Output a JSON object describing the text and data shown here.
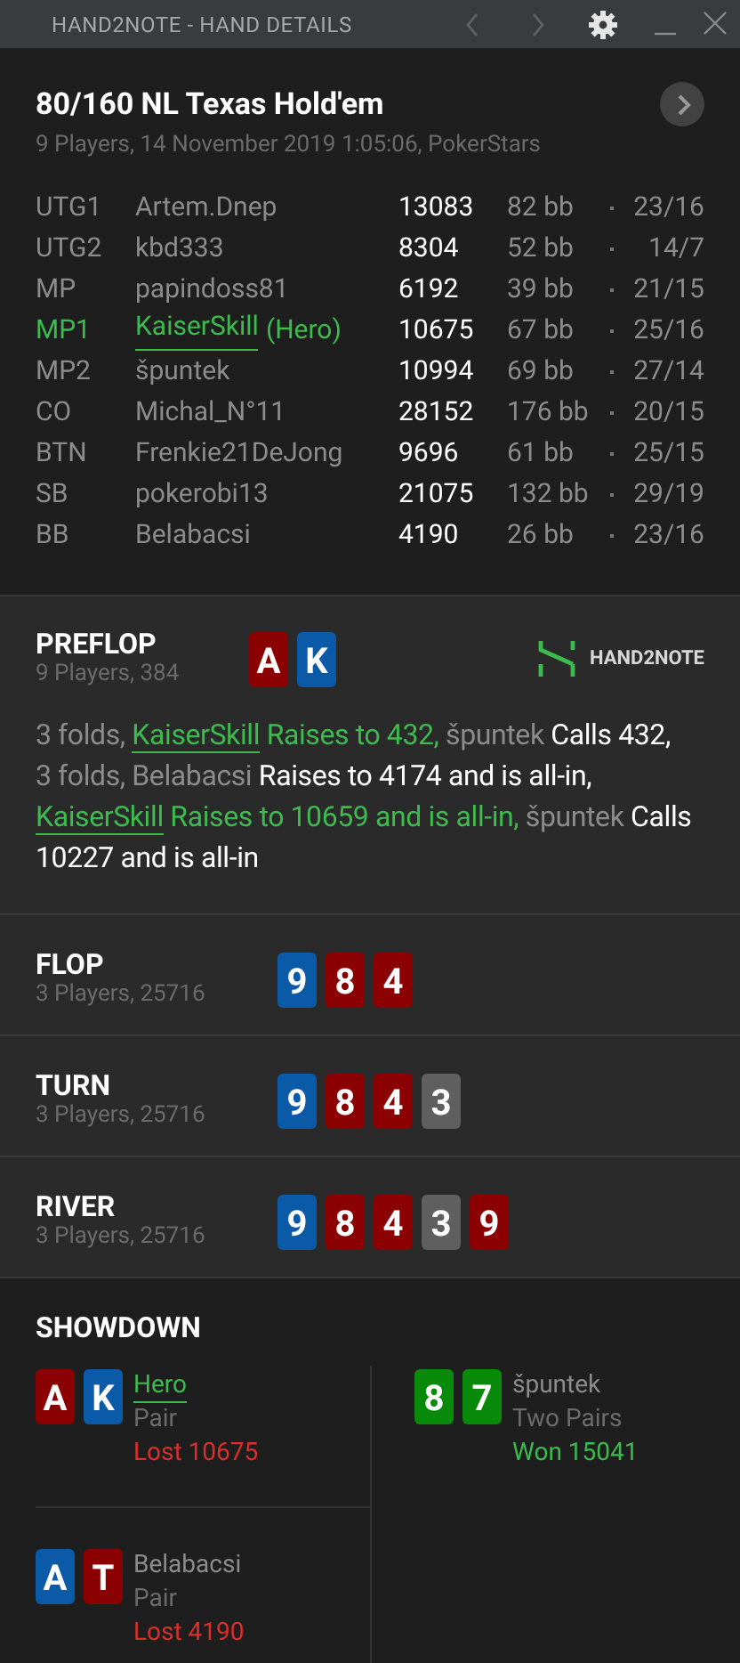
{
  "window": {
    "title": "HAND2NOTE - HAND DETAILS"
  },
  "hand": {
    "title": "80/160 NL Texas Hold'em",
    "subtitle": "9 Players, 14 November 2019 1:05:06, PokerStars"
  },
  "players": [
    {
      "position": "UTG1",
      "name": "Artem.Dnep",
      "stack": "13083",
      "bb": "82 bb",
      "ratio": "23/16",
      "hero": false
    },
    {
      "position": "UTG2",
      "name": "kbd333",
      "stack": "8304",
      "bb": "52 bb",
      "ratio": "14/7",
      "hero": false
    },
    {
      "position": "MP",
      "name": "papindoss81",
      "stack": "6192",
      "bb": "39 bb",
      "ratio": "21/15",
      "hero": false
    },
    {
      "position": "MP1",
      "name": "KaiserSkill",
      "suffix": "(Hero)",
      "stack": "10675",
      "bb": "67 bb",
      "ratio": "25/16",
      "hero": true
    },
    {
      "position": "MP2",
      "name": "špuntek",
      "stack": "10994",
      "bb": "69 bb",
      "ratio": "27/14",
      "hero": false
    },
    {
      "position": "CO",
      "name": "Michal_N°11",
      "stack": "28152",
      "bb": "176 bb",
      "ratio": "20/15",
      "hero": false
    },
    {
      "position": "BTN",
      "name": "Frenkie21DeJong",
      "stack": "9696",
      "bb": "61 bb",
      "ratio": "25/15",
      "hero": false
    },
    {
      "position": "SB",
      "name": "pokerobi13",
      "stack": "21075",
      "bb": "132 bb",
      "ratio": "29/19",
      "hero": false
    },
    {
      "position": "BB",
      "name": "Belabacsi",
      "stack": "4190",
      "bb": "26 bb",
      "ratio": "23/16",
      "hero": false
    }
  ],
  "streets": [
    {
      "name": "PREFLOP",
      "info": "9 Players, 384",
      "logo": "HAND2NOTE",
      "cards": [
        {
          "rank": "A",
          "color": "#8b0000"
        },
        {
          "rank": "K",
          "color": "#0b5aa8"
        }
      ],
      "actions": [
        {
          "kind": "muted",
          "text": "3 folds,"
        },
        {
          "kind": "hero_name",
          "text": "KaiserSkill"
        },
        {
          "kind": "hero_action",
          "text": "Raises to 432,"
        },
        {
          "kind": "name",
          "text": "špuntek"
        },
        {
          "kind": "action",
          "text": "Calls 432,"
        },
        {
          "kind": "muted",
          "text": "3 folds,"
        },
        {
          "kind": "name",
          "text": "Belabacsi"
        },
        {
          "kind": "action",
          "text": "Raises to 4174 and is all-in,"
        },
        {
          "kind": "hero_name",
          "text": "KaiserSkill"
        },
        {
          "kind": "hero_action",
          "text": "Raises to 10659 and is all-in,"
        },
        {
          "kind": "name",
          "text": "špuntek"
        },
        {
          "kind": "action",
          "text": "Calls 10227 and is all-in"
        }
      ]
    },
    {
      "name": "FLOP",
      "info": "3 Players, 25716",
      "cards": [
        {
          "rank": "9",
          "color": "#0b5aa8"
        },
        {
          "rank": "8",
          "color": "#8b0000"
        },
        {
          "rank": "4",
          "color": "#8b0000"
        }
      ]
    },
    {
      "name": "TURN",
      "info": "3 Players, 25716",
      "cards": [
        {
          "rank": "9",
          "color": "#0b5aa8"
        },
        {
          "rank": "8",
          "color": "#8b0000"
        },
        {
          "rank": "4",
          "color": "#8b0000"
        },
        {
          "rank": "3",
          "color": "#5f5f5f"
        }
      ]
    },
    {
      "name": "RIVER",
      "info": "3 Players, 25716",
      "cards": [
        {
          "rank": "9",
          "color": "#0b5aa8"
        },
        {
          "rank": "8",
          "color": "#8b0000"
        },
        {
          "rank": "4",
          "color": "#8b0000"
        },
        {
          "rank": "3",
          "color": "#5f5f5f"
        },
        {
          "rank": "9",
          "color": "#8b0000"
        }
      ]
    }
  ],
  "showdown": {
    "title": "SHOWDOWN",
    "hands": [
      {
        "player": "Hero",
        "hero": true,
        "hand": "Pair",
        "result": "Lost 10675",
        "won": false,
        "cards": [
          {
            "rank": "A",
            "color": "#8b0000"
          },
          {
            "rank": "K",
            "color": "#0b5aa8"
          }
        ]
      },
      {
        "player": "špuntek",
        "hero": false,
        "hand": "Two Pairs",
        "result": "Won 15041",
        "won": true,
        "cards": [
          {
            "rank": "8",
            "color": "#0a8a0a"
          },
          {
            "rank": "7",
            "color": "#0a8a0a"
          }
        ]
      },
      {
        "player": "Belabacsi",
        "hero": false,
        "hand": "Pair",
        "result": "Lost 4190",
        "won": false,
        "cards": [
          {
            "rank": "A",
            "color": "#0b5aa8"
          },
          {
            "rank": "T",
            "color": "#8b0000"
          }
        ]
      }
    ]
  }
}
